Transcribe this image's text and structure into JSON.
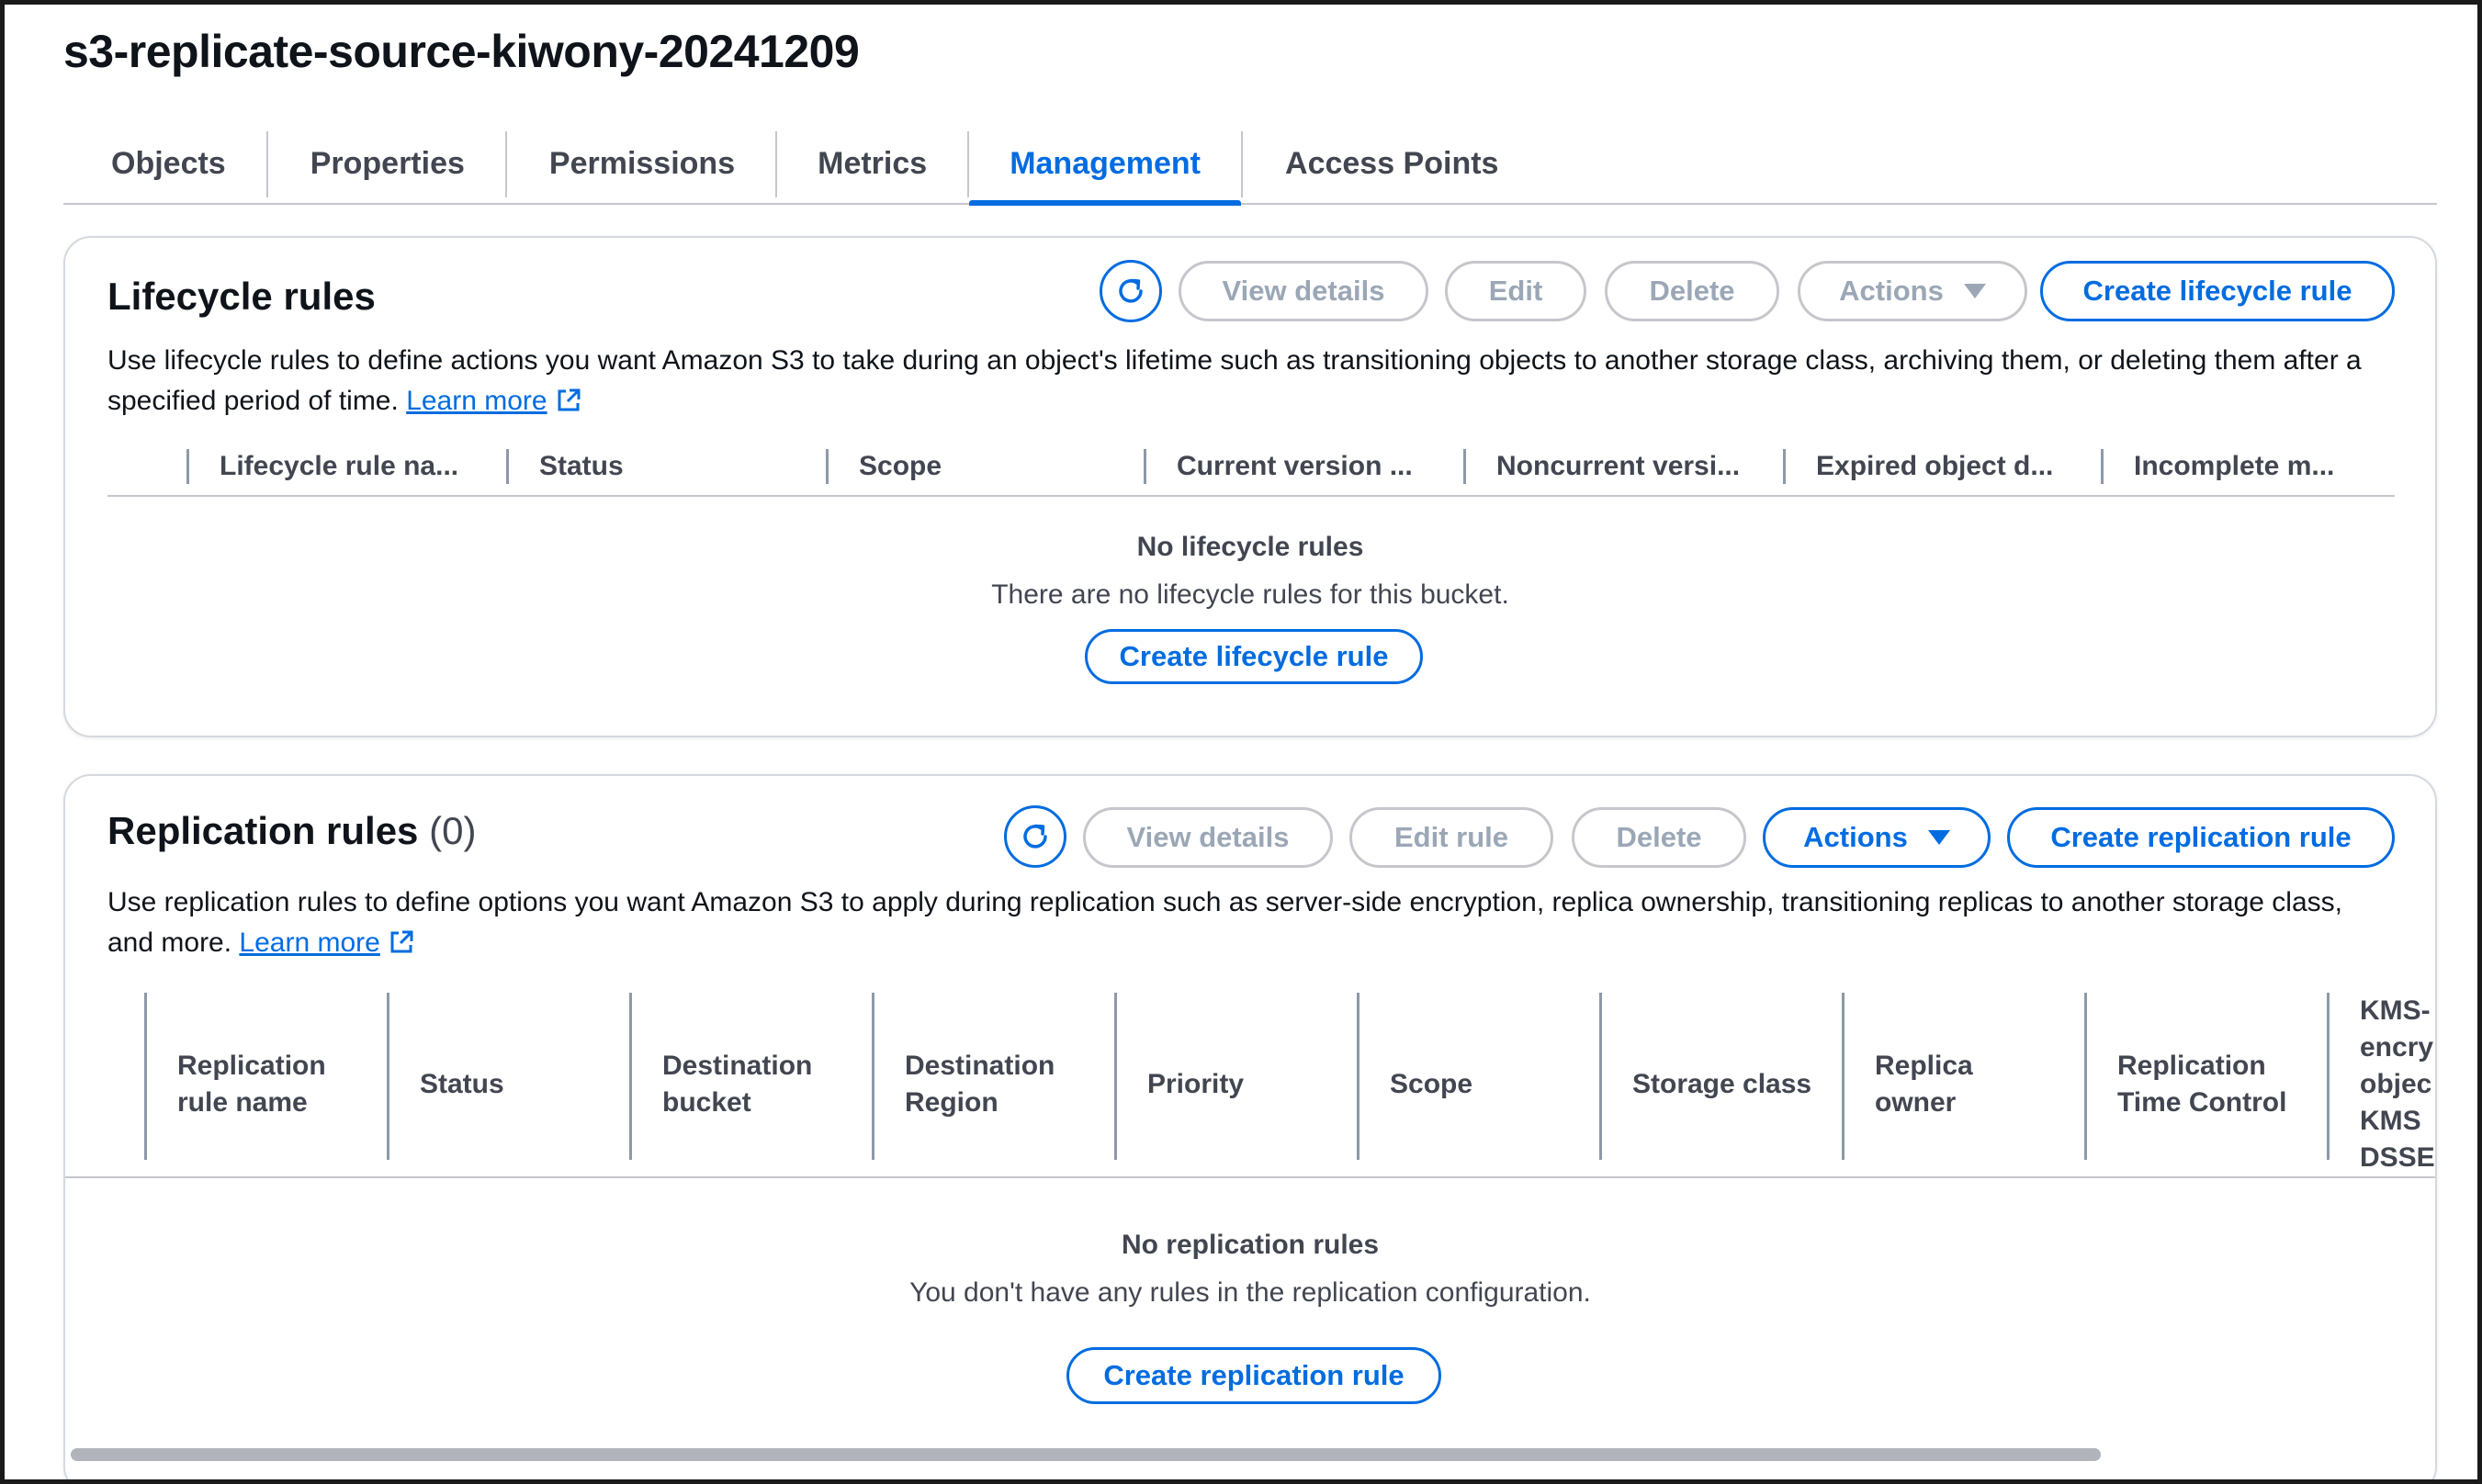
{
  "page": {
    "title": "s3-replicate-source-kiwony-20241209"
  },
  "tabs": [
    {
      "label": "Objects",
      "active": false
    },
    {
      "label": "Properties",
      "active": false
    },
    {
      "label": "Permissions",
      "active": false
    },
    {
      "label": "Metrics",
      "active": false
    },
    {
      "label": "Management",
      "active": true
    },
    {
      "label": "Access Points",
      "active": false
    }
  ],
  "lifecycle": {
    "title": "Lifecycle rules",
    "buttons": {
      "view_details": "View details",
      "edit": "Edit",
      "delete": "Delete",
      "actions": "Actions",
      "create": "Create lifecycle rule"
    },
    "description": "Use lifecycle rules to define actions you want Amazon S3 to take during an object's lifetime such as transitioning objects to another storage class, archiving them, or deleting them after a specified period of time.",
    "learn_more": "Learn more",
    "columns": [
      "Lifecycle rule na...",
      "Status",
      "Scope",
      "Current version ...",
      "Noncurrent versi...",
      "Expired object d...",
      "Incomplete m..."
    ],
    "empty_title": "No lifecycle rules",
    "empty_subtitle": "There are no lifecycle rules for this bucket.",
    "empty_button": "Create lifecycle rule"
  },
  "replication": {
    "title": "Replication rules",
    "count": "(0)",
    "buttons": {
      "view_details": "View details",
      "edit_rule": "Edit rule",
      "delete": "Delete",
      "actions": "Actions",
      "create": "Create replication rule"
    },
    "description": "Use replication rules to define options you want Amazon S3 to apply during replication such as server-side encryption, replica ownership, transitioning replicas to another storage class, and more.",
    "learn_more": "Learn more",
    "columns": [
      [
        "Replication",
        "rule name"
      ],
      [
        "Status"
      ],
      [
        "Destination",
        "bucket"
      ],
      [
        "Destination",
        "Region"
      ],
      [
        "Priority"
      ],
      [
        "Scope"
      ],
      [
        "Storage class"
      ],
      [
        "Replica",
        "owner"
      ],
      [
        "Replication",
        "Time Control"
      ],
      [
        "KMS-",
        "encry",
        "objec",
        "KMS",
        "DSSE"
      ]
    ],
    "empty_title": "No replication rules",
    "empty_subtitle": "You don't have any rules in the replication configuration.",
    "empty_button": "Create replication rule"
  },
  "colors": {
    "accent": "#006ce0",
    "disabled_text": "#9ba7b6",
    "border": "#c6c6cd"
  }
}
